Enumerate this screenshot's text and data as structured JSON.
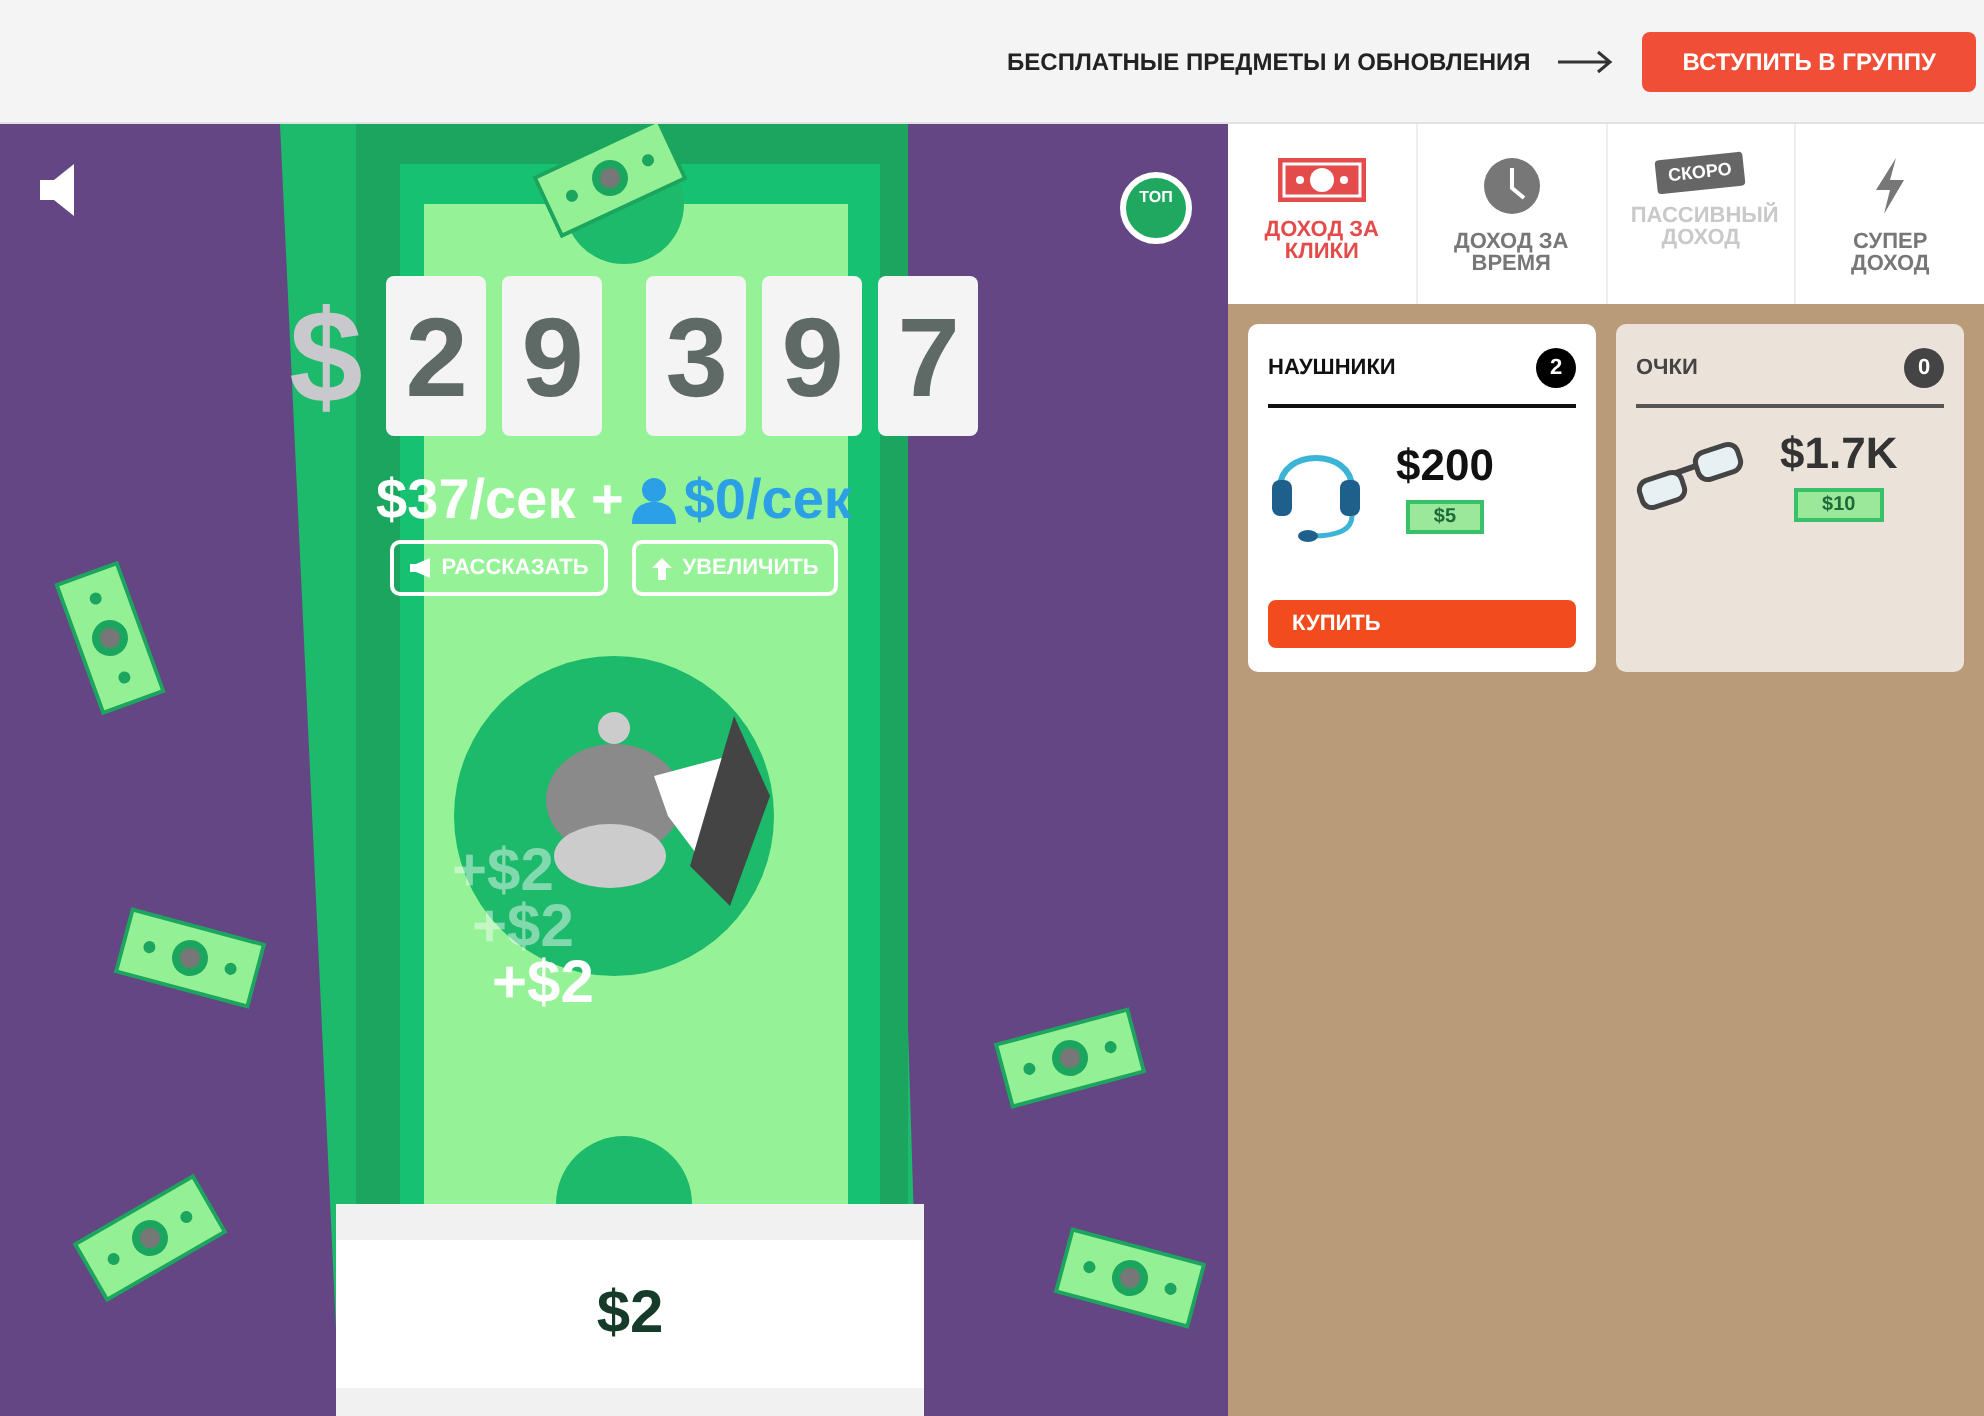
{
  "header": {
    "promo": "БЕСПЛАТНЫЕ ПРЕДМЕТЫ И ОБНОВЛЕНИЯ",
    "join_button": "ВСТУПИТЬ В ГРУППУ"
  },
  "game": {
    "sound_on": true,
    "top_badge": "ТОП",
    "currency": "$",
    "digits": [
      "2",
      "9",
      "3",
      "9",
      "7"
    ],
    "rate": "$37/сек +",
    "friends_rate": "$0/сек",
    "actions": [
      {
        "kind": "share",
        "label": "РАССКАЗАТЬ"
      },
      {
        "kind": "upgrade",
        "label": "УВЕЛИЧИТЬ"
      }
    ],
    "floats": [
      "+$2",
      "+$2",
      "+$2"
    ],
    "click_value": "$2"
  },
  "tabs": [
    {
      "kind": "bill",
      "label": "ДОХОД ЗА КЛИКИ",
      "selected": true,
      "disabled": false
    },
    {
      "kind": "clock",
      "label": "ДОХОД ЗА ВРЕМЯ",
      "selected": false,
      "disabled": false
    },
    {
      "kind": "soon",
      "label": "ПАССИВНЫЙ ДОХОД",
      "badge": "СКОРО",
      "selected": false,
      "disabled": true
    },
    {
      "kind": "bolt",
      "label": "СУПЕР ДОХОД",
      "selected": false,
      "disabled": false
    }
  ],
  "items": [
    {
      "kind": "headphones",
      "name": "НАУШНИКИ",
      "count": "2",
      "price": "$200",
      "income": "$5",
      "affordable": true,
      "buy": "КУПИТЬ"
    },
    {
      "kind": "glasses",
      "name": "ОЧКИ",
      "count": "0",
      "price": "$1.7K",
      "income": "$10",
      "affordable": false
    }
  ]
}
